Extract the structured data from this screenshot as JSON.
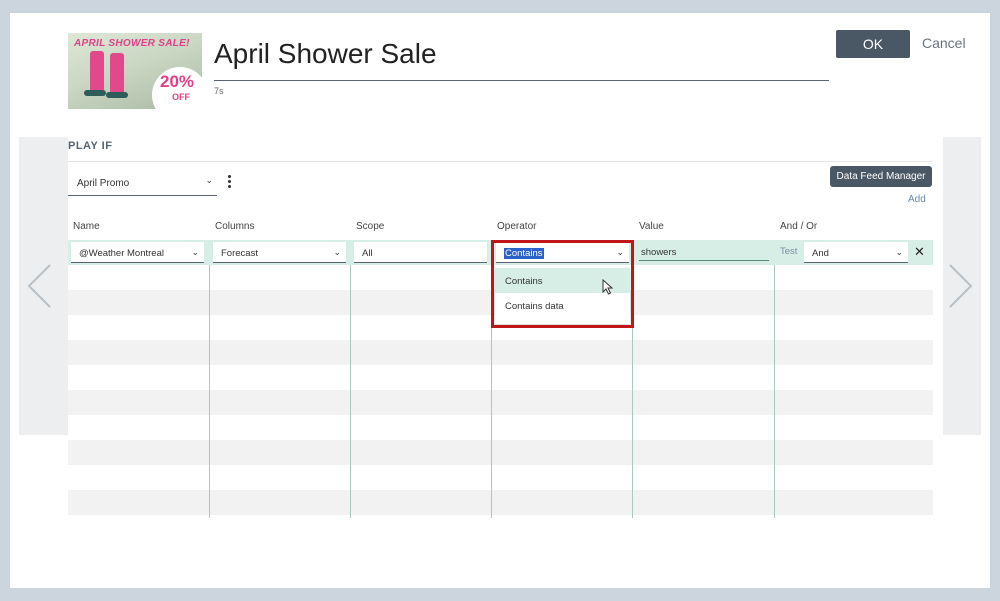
{
  "header": {
    "title": "April Shower Sale",
    "duration": "7s",
    "ok_label": "OK",
    "cancel_label": "Cancel",
    "thumbnail": {
      "sale_text": "APRIL SHOWER SALE!",
      "discount": "20%",
      "off": "OFF"
    }
  },
  "play_if": {
    "section_label": "PLAY IF",
    "feed_select": "April Promo",
    "data_feed_manager_label": "Data Feed Manager",
    "add_label": "Add"
  },
  "columns": {
    "name": "Name",
    "columns": "Columns",
    "scope": "Scope",
    "operator": "Operator",
    "value": "Value",
    "and_or": "And / Or"
  },
  "row": {
    "name": "@Weather Montreal",
    "column": "Forecast",
    "scope": "All",
    "operator": "Contains",
    "value": "showers",
    "test_label": "Test",
    "and_or": "And"
  },
  "operator_dropdown": {
    "options": [
      "Contains",
      "Contains data"
    ],
    "hovered_index": 0
  },
  "colors": {
    "accent_dark": "#4a5866",
    "row_highlight": "#d6eee6",
    "highlight_box": "#c0161a"
  }
}
